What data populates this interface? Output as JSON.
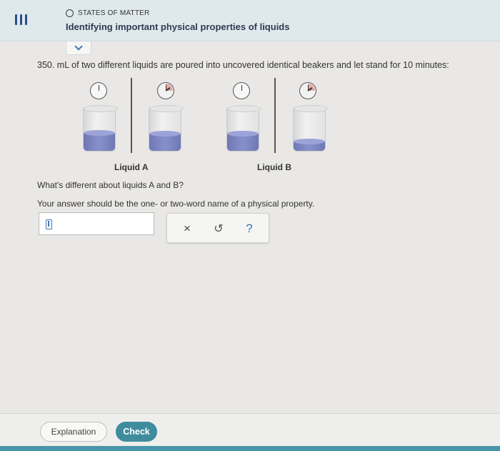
{
  "header": {
    "topic": "STATES OF MATTER",
    "title": "Identifying important physical properties of liquids"
  },
  "question": {
    "intro": "350. mL of two different liquids are poured into uncovered identical beakers and let stand for 10 minutes:",
    "liquid_a_label": "Liquid A",
    "liquid_b_label": "Liquid B",
    "liquid_a_level_start": 0.42,
    "liquid_a_level_end": 0.4,
    "liquid_b_level_start": 0.4,
    "liquid_b_level_end": 0.22,
    "prompt": "What's different about liquids A and B?",
    "instruction": "Your answer should be the one- or two-word name of a physical property."
  },
  "answer": {
    "value": ""
  },
  "tools": {
    "clear": "×",
    "undo": "↺",
    "help": "?"
  },
  "footer": {
    "explanation_label": "Explanation",
    "check_label": "Check"
  },
  "colors": {
    "header_bg": "#dfe9ec",
    "accent": "#3f8c9e",
    "liquid": "#7880be",
    "bottom_strip": "#4795a8"
  }
}
